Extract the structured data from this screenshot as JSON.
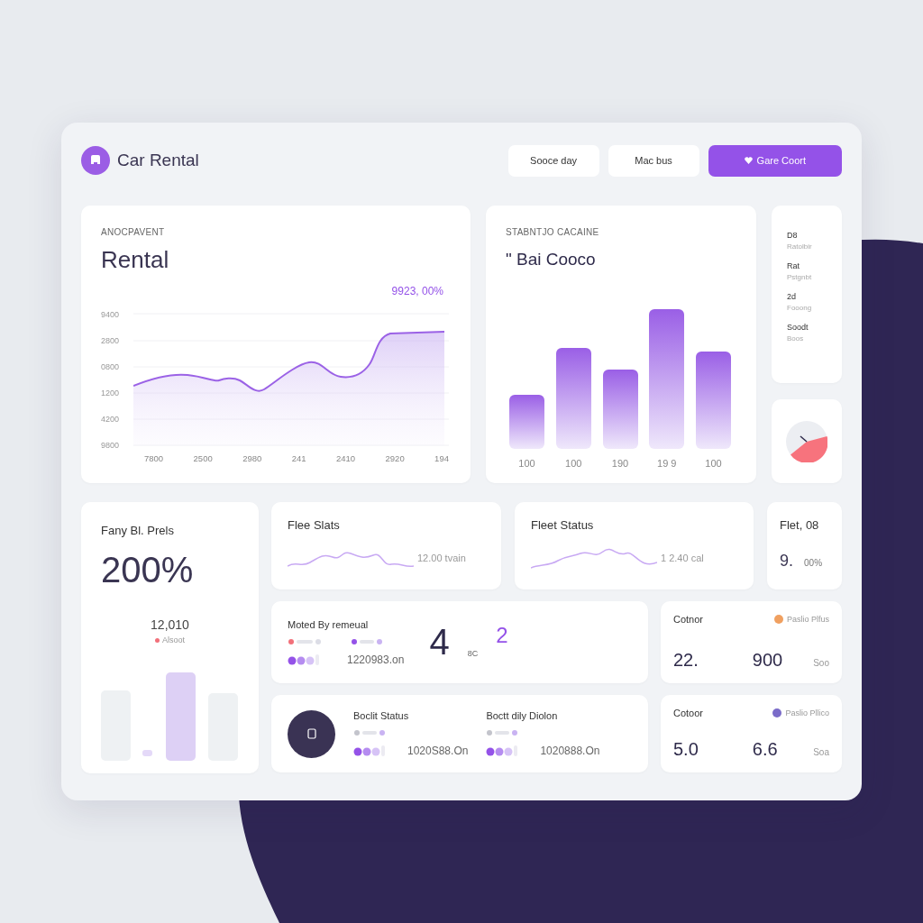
{
  "header": {
    "title": "Car Rental",
    "buttons": [
      {
        "label": "Sooce day",
        "kind": "plain"
      },
      {
        "label": "Mac bus",
        "kind": "plain"
      },
      {
        "label": "Gare Coort",
        "kind": "primary"
      }
    ]
  },
  "rental_chart": {
    "overline": "ANOCPAVENT",
    "title": "Rental",
    "highlight": "9923, 00%",
    "y_labels": [
      "9400",
      "2800",
      "0800",
      "1200",
      "4200",
      "9800"
    ],
    "x_labels": [
      "7800",
      "2500",
      "2980",
      "241",
      "2410",
      "2920",
      "194"
    ]
  },
  "bar_chart": {
    "overline": "STABNTJO CACAINE",
    "title": "\" Bai Cooco",
    "bar_labels": [
      "100",
      "100",
      "190",
      "19 9",
      "100"
    ]
  },
  "side_list": [
    {
      "title": "D8",
      "subtitle": "Ratolbir"
    },
    {
      "title": "Rat",
      "subtitle": "Pstgnbt"
    },
    {
      "title": "2d",
      "subtitle": "Fooong"
    },
    {
      "title": "Soodt",
      "subtitle": "Boos"
    }
  ],
  "left_card": {
    "label": "Fany Bl. Prels",
    "value": "200%",
    "sub_value": "12,010",
    "note": "Alsoot"
  },
  "fleet_cards": [
    {
      "title": "Flee Slats",
      "reading": "12.00 tvain"
    },
    {
      "title": "Fleet Status",
      "reading": "1 2.40 cal"
    }
  ],
  "small_card": {
    "title": "Flet, 08",
    "value": "9.",
    "unit": "00%"
  },
  "booking_cards": [
    {
      "kind": "stat",
      "title": "Moted By remeual",
      "reading": "1220983.on",
      "big": "4",
      "unit": "8C",
      "accent": "2"
    },
    {
      "kind": "status",
      "groups": [
        {
          "title": "Boclit Status",
          "reading": "1020S88.On"
        },
        {
          "title": "Boctt dily Diolon",
          "reading": "1020888.On"
        }
      ]
    }
  ],
  "metric_cards": [
    {
      "label": "Cotnor",
      "legend": "Paslio Plfus",
      "value_a": "22.",
      "value_b": "900",
      "unit": "Soo"
    },
    {
      "label": "Cotoor",
      "legend": "Paslio Pllico",
      "value_a": "5.0",
      "value_b": "6.6",
      "unit": "Soa"
    }
  ]
}
